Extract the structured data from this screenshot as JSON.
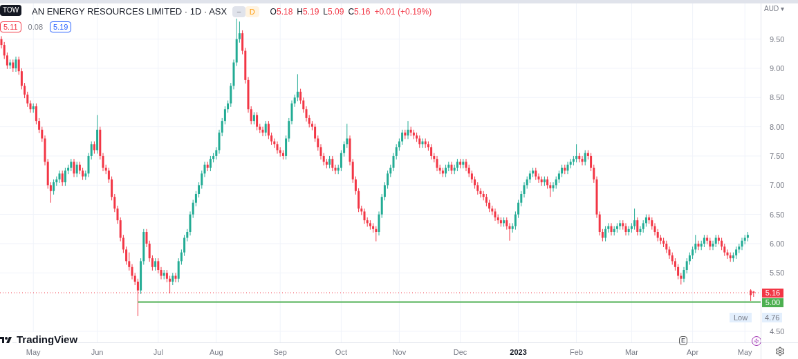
{
  "legend": {
    "tooltip": "TOW",
    "title": "AN ENERGY RESOURCES LIMITED · 1D · ASX",
    "badges": [
      {
        "text": "−",
        "kind": "grey"
      },
      {
        "text": "D",
        "kind": "orange"
      }
    ],
    "ohlc": [
      {
        "label": "O",
        "value": "5.18"
      },
      {
        "label": "H",
        "value": "5.19"
      },
      {
        "label": "L",
        "value": "5.09"
      },
      {
        "label": "C",
        "value": "5.16"
      }
    ],
    "change": "+0.01 (+0.19%)",
    "values": [
      {
        "text": "5.11",
        "kind": "red-box"
      },
      {
        "text": "0.08",
        "kind": "plain"
      },
      {
        "text": "5.19",
        "kind": "blue-box"
      }
    ]
  },
  "price_axis": {
    "currency": "AUD",
    "currency_caret": "▾",
    "low": {
      "label": "Low",
      "value": "4.76"
    }
  },
  "logo": "TradingView",
  "earnings_marker": "E",
  "chart": {
    "xtick_bold": [
      false,
      false,
      false,
      false,
      false,
      false,
      false,
      false,
      true,
      false,
      false,
      false,
      false
    ],
    "chart_data": {
      "type": "candlestick",
      "yticks": [
        {
          "value": 9.5,
          "label": "9.50"
        },
        {
          "value": 9,
          "label": "9.00"
        },
        {
          "value": 8.5,
          "label": "8.50"
        },
        {
          "value": 8,
          "label": "8.00"
        },
        {
          "value": 7.5,
          "label": "7.50"
        },
        {
          "value": 7,
          "label": "7.00"
        },
        {
          "value": 6.5,
          "label": "6.50"
        },
        {
          "value": 6,
          "label": "6.00"
        },
        {
          "value": 5.5,
          "label": "5.50"
        },
        {
          "value": 4.5,
          "label": "4.50"
        }
      ],
      "ylim": [
        4.31,
        10.11
      ],
      "grid": true,
      "ref_lines": [
        {
          "axis": "y",
          "value": 5.16,
          "label": "5.16",
          "color": "#f23645"
        },
        {
          "axis": "y",
          "value": 5,
          "label": "5.00",
          "color": "#4caf50"
        }
      ],
      "categories": [
        null,
        null,
        null,
        null,
        null,
        null,
        null,
        null,
        null,
        null,
        null,
        "May",
        null,
        null,
        null,
        null,
        null,
        null,
        null,
        null,
        null,
        null,
        null,
        null,
        null,
        null,
        null,
        null,
        null,
        null,
        null,
        null,
        null,
        "Jun",
        null,
        null,
        null,
        null,
        null,
        null,
        null,
        null,
        null,
        null,
        null,
        null,
        null,
        null,
        null,
        null,
        null,
        null,
        null,
        null,
        "Jul",
        null,
        null,
        null,
        null,
        null,
        null,
        null,
        null,
        null,
        null,
        null,
        null,
        null,
        null,
        null,
        null,
        null,
        null,
        null,
        "Aug",
        null,
        null,
        null,
        null,
        null,
        null,
        null,
        null,
        null,
        null,
        null,
        null,
        null,
        null,
        null,
        null,
        null,
        null,
        null,
        null,
        null,
        "Sep",
        null,
        null,
        null,
        null,
        null,
        null,
        null,
        null,
        null,
        null,
        null,
        null,
        null,
        null,
        null,
        null,
        null,
        null,
        null,
        null,
        "Oct",
        null,
        null,
        null,
        null,
        null,
        null,
        null,
        null,
        null,
        null,
        null,
        null,
        null,
        null,
        null,
        null,
        null,
        null,
        null,
        "Nov",
        null,
        null,
        null,
        null,
        null,
        null,
        null,
        null,
        null,
        null,
        null,
        null,
        null,
        null,
        null,
        null,
        null,
        null,
        null,
        null,
        "Dec",
        null,
        null,
        null,
        null,
        null,
        null,
        null,
        null,
        null,
        null,
        null,
        null,
        null,
        null,
        null,
        null,
        null,
        null,
        null,
        "2023",
        null,
        null,
        null,
        null,
        null,
        null,
        null,
        null,
        null,
        null,
        null,
        null,
        null,
        null,
        null,
        null,
        null,
        null,
        null,
        "Feb",
        null,
        null,
        null,
        null,
        null,
        null,
        null,
        null,
        null,
        null,
        null,
        null,
        null,
        null,
        null,
        null,
        null,
        null,
        "Mar",
        null,
        null,
        null,
        null,
        null,
        null,
        null,
        null,
        null,
        null,
        null,
        null,
        null,
        null,
        null,
        null,
        null,
        null,
        null,
        null,
        "Apr",
        null,
        null,
        null,
        null,
        null,
        null,
        null,
        null,
        null,
        null,
        null,
        null,
        null,
        null,
        null,
        null,
        null,
        "May",
        null,
        null,
        null
      ],
      "ohlc": [
        [
          9.5,
          9.55,
          9.34,
          9.4
        ],
        [
          9.4,
          9.45,
          9.16,
          9.22
        ],
        [
          9.22,
          9.27,
          8.99,
          9.05
        ],
        [
          9.05,
          9.15,
          8.99,
          9.1
        ],
        [
          9.1,
          9.15,
          8.94,
          9.0
        ],
        [
          9.0,
          9.2,
          8.94,
          9.15
        ],
        [
          9.15,
          9.2,
          8.89,
          8.95
        ],
        [
          8.95,
          9.0,
          8.64,
          8.7
        ],
        [
          8.7,
          8.75,
          8.49,
          8.55
        ],
        [
          8.55,
          8.6,
          8.34,
          8.4
        ],
        [
          8.4,
          8.45,
          8.24,
          8.3
        ],
        [
          8.3,
          8.4,
          8.24,
          8.35
        ],
        [
          8.35,
          8.4,
          8.04,
          8.1
        ],
        [
          8.1,
          8.15,
          7.89,
          7.95
        ],
        [
          7.95,
          8.0,
          7.74,
          7.8
        ],
        [
          7.8,
          7.85,
          7.34,
          7.4
        ],
        [
          7.4,
          7.45,
          6.94,
          7.0
        ],
        [
          7.0,
          7.05,
          6.7,
          6.9
        ],
        [
          6.9,
          7.1,
          6.84,
          7.05
        ],
        [
          7.05,
          7.15,
          6.99,
          7.1
        ],
        [
          7.1,
          7.25,
          7.04,
          7.2
        ],
        [
          7.2,
          7.25,
          6.99,
          7.05
        ],
        [
          7.05,
          7.3,
          6.99,
          7.25
        ],
        [
          7.25,
          7.35,
          7.19,
          7.3
        ],
        [
          7.3,
          7.45,
          7.24,
          7.4
        ],
        [
          7.4,
          7.45,
          7.14,
          7.2
        ],
        [
          7.2,
          7.4,
          7.14,
          7.35
        ],
        [
          7.35,
          7.4,
          7.19,
          7.25
        ],
        [
          7.25,
          7.3,
          7.09,
          7.15
        ],
        [
          7.15,
          7.25,
          7.09,
          7.2
        ],
        [
          7.2,
          7.55,
          7.14,
          7.5
        ],
        [
          7.5,
          7.75,
          7.44,
          7.7
        ],
        [
          7.7,
          7.75,
          7.54,
          7.6
        ],
        [
          7.6,
          8.2,
          7.54,
          7.95
        ],
        [
          7.95,
          8.0,
          7.44,
          7.5
        ],
        [
          7.5,
          7.55,
          7.24,
          7.3
        ],
        [
          7.3,
          7.35,
          7.19,
          7.25
        ],
        [
          7.25,
          7.3,
          7.04,
          7.1
        ],
        [
          7.1,
          7.15,
          6.74,
          6.8
        ],
        [
          6.8,
          6.85,
          6.54,
          6.6
        ],
        [
          6.6,
          6.65,
          6.34,
          6.4
        ],
        [
          6.4,
          6.45,
          6.04,
          6.1
        ],
        [
          6.1,
          6.15,
          5.84,
          5.9
        ],
        [
          5.9,
          5.95,
          5.64,
          5.7
        ],
        [
          5.7,
          5.85,
          5.54,
          5.6
        ],
        [
          5.6,
          5.65,
          5.39,
          5.45
        ],
        [
          5.45,
          5.5,
          5.29,
          5.35
        ],
        [
          5.35,
          5.4,
          4.76,
          5.2
        ],
        [
          5.2,
          5.75,
          5.14,
          5.7
        ],
        [
          5.7,
          6.25,
          5.64,
          6.2
        ],
        [
          6.2,
          6.25,
          5.94,
          6.0
        ],
        [
          6.0,
          6.05,
          5.69,
          5.75
        ],
        [
          5.75,
          5.8,
          5.54,
          5.6
        ],
        [
          5.6,
          5.75,
          5.54,
          5.7
        ],
        [
          5.7,
          5.75,
          5.49,
          5.55
        ],
        [
          5.55,
          5.6,
          5.39,
          5.45
        ],
        [
          5.45,
          5.55,
          5.39,
          5.5
        ],
        [
          5.5,
          5.55,
          5.34,
          5.4
        ],
        [
          5.4,
          5.45,
          5.15,
          5.35
        ],
        [
          5.35,
          5.5,
          5.29,
          5.45
        ],
        [
          5.45,
          5.5,
          5.34,
          5.4
        ],
        [
          5.4,
          5.75,
          5.34,
          5.7
        ],
        [
          5.7,
          5.9,
          5.64,
          5.85
        ],
        [
          5.85,
          6.15,
          5.79,
          6.1
        ],
        [
          6.1,
          6.25,
          6.04,
          6.2
        ],
        [
          6.2,
          6.55,
          6.14,
          6.5
        ],
        [
          6.5,
          6.75,
          6.44,
          6.7
        ],
        [
          6.7,
          6.9,
          6.64,
          6.85
        ],
        [
          6.85,
          7.05,
          6.79,
          7.0
        ],
        [
          7.0,
          7.25,
          6.94,
          7.2
        ],
        [
          7.2,
          7.4,
          7.14,
          7.35
        ],
        [
          7.35,
          7.4,
          7.24,
          7.3
        ],
        [
          7.3,
          7.5,
          7.24,
          7.45
        ],
        [
          7.45,
          7.55,
          7.39,
          7.5
        ],
        [
          7.5,
          7.65,
          7.44,
          7.6
        ],
        [
          7.6,
          7.95,
          7.54,
          7.9
        ],
        [
          7.9,
          8.15,
          7.84,
          8.1
        ],
        [
          8.1,
          8.35,
          8.04,
          8.3
        ],
        [
          8.3,
          8.45,
          8.24,
          8.4
        ],
        [
          8.4,
          8.75,
          8.34,
          8.7
        ],
        [
          8.7,
          9.15,
          8.64,
          9.1
        ],
        [
          9.1,
          9.85,
          9.04,
          9.5
        ],
        [
          9.5,
          9.8,
          9.44,
          9.6
        ],
        [
          9.6,
          9.65,
          9.24,
          9.3
        ],
        [
          9.3,
          9.35,
          8.74,
          8.8
        ],
        [
          8.8,
          8.85,
          8.24,
          8.3
        ],
        [
          8.3,
          8.35,
          8.04,
          8.1
        ],
        [
          8.1,
          8.25,
          8.04,
          8.2
        ],
        [
          8.2,
          8.25,
          7.94,
          8.0
        ],
        [
          8.0,
          8.05,
          7.89,
          7.95
        ],
        [
          7.95,
          8.0,
          7.84,
          7.9
        ],
        [
          7.9,
          8.1,
          7.84,
          8.05
        ],
        [
          8.05,
          8.1,
          7.79,
          7.85
        ],
        [
          7.85,
          7.9,
          7.69,
          7.75
        ],
        [
          7.75,
          7.8,
          7.64,
          7.7
        ],
        [
          7.7,
          7.75,
          7.54,
          7.6
        ],
        [
          7.6,
          7.65,
          7.49,
          7.55
        ],
        [
          7.55,
          7.6,
          7.44,
          7.5
        ],
        [
          7.5,
          7.85,
          7.44,
          7.8
        ],
        [
          7.8,
          8.15,
          7.74,
          8.1
        ],
        [
          8.1,
          8.45,
          8.04,
          8.4
        ],
        [
          8.4,
          8.55,
          8.34,
          8.5
        ],
        [
          8.5,
          8.9,
          8.44,
          8.6
        ],
        [
          8.6,
          8.65,
          8.39,
          8.45
        ],
        [
          8.45,
          8.5,
          8.24,
          8.3
        ],
        [
          8.3,
          8.35,
          8.09,
          8.15
        ],
        [
          8.15,
          8.2,
          7.99,
          8.05
        ],
        [
          8.05,
          8.1,
          7.94,
          8.0
        ],
        [
          8.0,
          8.05,
          7.74,
          7.8
        ],
        [
          7.8,
          7.85,
          7.59,
          7.65
        ],
        [
          7.65,
          7.7,
          7.44,
          7.5
        ],
        [
          7.5,
          7.55,
          7.34,
          7.4
        ],
        [
          7.4,
          7.45,
          7.29,
          7.35
        ],
        [
          7.35,
          7.5,
          7.29,
          7.45
        ],
        [
          7.45,
          7.5,
          7.24,
          7.3
        ],
        [
          7.3,
          7.35,
          7.19,
          7.25
        ],
        [
          7.25,
          7.35,
          7.19,
          7.3
        ],
        [
          7.3,
          7.6,
          7.24,
          7.55
        ],
        [
          7.55,
          7.75,
          7.49,
          7.7
        ],
        [
          7.7,
          8.05,
          7.64,
          7.8
        ],
        [
          7.8,
          7.85,
          7.34,
          7.4
        ],
        [
          7.4,
          7.45,
          7.04,
          7.1
        ],
        [
          7.1,
          7.15,
          6.84,
          6.9
        ],
        [
          6.9,
          6.95,
          6.54,
          6.6
        ],
        [
          6.6,
          6.65,
          6.49,
          6.55
        ],
        [
          6.55,
          6.6,
          6.34,
          6.4
        ],
        [
          6.4,
          6.45,
          6.29,
          6.35
        ],
        [
          6.35,
          6.4,
          6.24,
          6.3
        ],
        [
          6.3,
          6.35,
          6.19,
          6.25
        ],
        [
          6.25,
          6.3,
          6.04,
          6.2
        ],
        [
          6.2,
          6.55,
          6.14,
          6.5
        ],
        [
          6.5,
          6.85,
          6.44,
          6.8
        ],
        [
          6.8,
          7.05,
          6.74,
          7.0
        ],
        [
          7.0,
          7.25,
          6.94,
          7.2
        ],
        [
          7.2,
          7.35,
          7.14,
          7.3
        ],
        [
          7.3,
          7.55,
          7.24,
          7.5
        ],
        [
          7.5,
          7.7,
          7.44,
          7.65
        ],
        [
          7.65,
          7.8,
          7.59,
          7.75
        ],
        [
          7.75,
          7.95,
          7.69,
          7.9
        ],
        [
          7.9,
          7.95,
          7.79,
          7.85
        ],
        [
          7.85,
          8.1,
          7.79,
          7.95
        ],
        [
          7.95,
          8.0,
          7.84,
          7.9
        ],
        [
          7.9,
          7.95,
          7.79,
          7.85
        ],
        [
          7.85,
          7.9,
          7.74,
          7.8
        ],
        [
          7.8,
          7.85,
          7.64,
          7.7
        ],
        [
          7.7,
          7.8,
          7.64,
          7.75
        ],
        [
          7.75,
          7.8,
          7.64,
          7.7
        ],
        [
          7.7,
          7.75,
          7.59,
          7.65
        ],
        [
          7.65,
          7.7,
          7.44,
          7.5
        ],
        [
          7.5,
          7.55,
          7.39,
          7.45
        ],
        [
          7.45,
          7.5,
          7.24,
          7.3
        ],
        [
          7.3,
          7.35,
          7.19,
          7.25
        ],
        [
          7.25,
          7.3,
          7.14,
          7.2
        ],
        [
          7.2,
          7.35,
          7.14,
          7.3
        ],
        [
          7.3,
          7.4,
          7.24,
          7.35
        ],
        [
          7.35,
          7.4,
          7.19,
          7.25
        ],
        [
          7.25,
          7.35,
          7.19,
          7.3
        ],
        [
          7.3,
          7.45,
          7.24,
          7.4
        ],
        [
          7.4,
          7.45,
          7.29,
          7.35
        ],
        [
          7.35,
          7.45,
          7.29,
          7.4
        ],
        [
          7.4,
          7.45,
          7.24,
          7.3
        ],
        [
          7.3,
          7.35,
          7.14,
          7.2
        ],
        [
          7.2,
          7.25,
          7.04,
          7.1
        ],
        [
          7.1,
          7.15,
          6.94,
          7.0
        ],
        [
          7.0,
          7.05,
          6.84,
          6.9
        ],
        [
          6.9,
          6.95,
          6.79,
          6.85
        ],
        [
          6.85,
          6.9,
          6.74,
          6.8
        ],
        [
          6.8,
          6.85,
          6.64,
          6.7
        ],
        [
          6.7,
          6.75,
          6.54,
          6.6
        ],
        [
          6.6,
          6.65,
          6.49,
          6.55
        ],
        [
          6.55,
          6.6,
          6.39,
          6.45
        ],
        [
          6.45,
          6.5,
          6.34,
          6.4
        ],
        [
          6.4,
          6.45,
          6.29,
          6.35
        ],
        [
          6.35,
          6.45,
          6.29,
          6.4
        ],
        [
          6.4,
          6.45,
          6.24,
          6.3
        ],
        [
          6.3,
          6.35,
          6.05,
          6.25
        ],
        [
          6.25,
          6.35,
          6.19,
          6.3
        ],
        [
          6.3,
          6.55,
          6.24,
          6.5
        ],
        [
          6.5,
          6.75,
          6.44,
          6.7
        ],
        [
          6.7,
          6.9,
          6.64,
          6.85
        ],
        [
          6.85,
          7.05,
          6.79,
          7.0
        ],
        [
          7.0,
          7.15,
          6.94,
          7.1
        ],
        [
          7.1,
          7.25,
          7.04,
          7.2
        ],
        [
          7.2,
          7.3,
          7.14,
          7.25
        ],
        [
          7.25,
          7.3,
          7.09,
          7.15
        ],
        [
          7.15,
          7.2,
          7.04,
          7.1
        ],
        [
          7.1,
          7.15,
          6.99,
          7.05
        ],
        [
          7.05,
          7.15,
          6.99,
          7.1
        ],
        [
          7.1,
          7.15,
          6.94,
          7.0
        ],
        [
          7.0,
          7.05,
          6.8,
          6.95
        ],
        [
          6.95,
          7.05,
          6.89,
          7.0
        ],
        [
          7.0,
          7.15,
          6.94,
          7.1
        ],
        [
          7.1,
          7.25,
          7.04,
          7.2
        ],
        [
          7.2,
          7.35,
          7.14,
          7.3
        ],
        [
          7.3,
          7.35,
          7.19,
          7.25
        ],
        [
          7.25,
          7.4,
          7.19,
          7.35
        ],
        [
          7.35,
          7.45,
          7.29,
          7.4
        ],
        [
          7.4,
          7.5,
          7.34,
          7.45
        ],
        [
          7.45,
          7.7,
          7.39,
          7.5
        ],
        [
          7.5,
          7.55,
          7.39,
          7.45
        ],
        [
          7.45,
          7.5,
          7.34,
          7.4
        ],
        [
          7.4,
          7.6,
          7.34,
          7.55
        ],
        [
          7.55,
          7.6,
          7.44,
          7.5
        ],
        [
          7.5,
          7.55,
          7.24,
          7.3
        ],
        [
          7.3,
          7.35,
          7.04,
          7.1
        ],
        [
          7.1,
          7.15,
          6.44,
          6.5
        ],
        [
          6.5,
          6.55,
          6.14,
          6.2
        ],
        [
          6.2,
          6.25,
          6.04,
          6.1
        ],
        [
          6.1,
          6.3,
          6.04,
          6.25
        ],
        [
          6.25,
          6.35,
          6.19,
          6.3
        ],
        [
          6.3,
          6.35,
          6.14,
          6.2
        ],
        [
          6.2,
          6.3,
          6.14,
          6.25
        ],
        [
          6.25,
          6.35,
          6.19,
          6.3
        ],
        [
          6.3,
          6.4,
          6.24,
          6.35
        ],
        [
          6.35,
          6.4,
          6.24,
          6.3
        ],
        [
          6.3,
          6.35,
          6.14,
          6.2
        ],
        [
          6.2,
          6.3,
          6.14,
          6.25
        ],
        [
          6.25,
          6.35,
          6.19,
          6.3
        ],
        [
          6.3,
          6.6,
          6.24,
          6.4
        ],
        [
          6.4,
          6.45,
          6.14,
          6.2
        ],
        [
          6.2,
          6.3,
          6.14,
          6.25
        ],
        [
          6.25,
          6.4,
          6.19,
          6.35
        ],
        [
          6.35,
          6.5,
          6.29,
          6.45
        ],
        [
          6.45,
          6.5,
          6.34,
          6.4
        ],
        [
          6.4,
          6.45,
          6.24,
          6.3
        ],
        [
          6.3,
          6.35,
          6.14,
          6.2
        ],
        [
          6.2,
          6.25,
          6.04,
          6.1
        ],
        [
          6.1,
          6.15,
          5.99,
          6.05
        ],
        [
          6.05,
          6.1,
          5.94,
          6.0
        ],
        [
          6.0,
          6.05,
          5.84,
          5.9
        ],
        [
          5.9,
          5.95,
          5.74,
          5.8
        ],
        [
          5.8,
          5.85,
          5.64,
          5.7
        ],
        [
          5.7,
          5.75,
          5.54,
          5.6
        ],
        [
          5.6,
          5.65,
          5.39,
          5.45
        ],
        [
          5.45,
          5.5,
          5.3,
          5.4
        ],
        [
          5.4,
          5.6,
          5.34,
          5.55
        ],
        [
          5.55,
          5.75,
          5.49,
          5.7
        ],
        [
          5.7,
          5.85,
          5.64,
          5.8
        ],
        [
          5.8,
          5.95,
          5.74,
          5.9
        ],
        [
          5.9,
          6.15,
          5.84,
          6.0
        ],
        [
          6.0,
          6.05,
          5.89,
          5.95
        ],
        [
          5.95,
          6.05,
          5.89,
          6.0
        ],
        [
          6.0,
          6.15,
          5.94,
          6.1
        ],
        [
          6.1,
          6.15,
          5.99,
          6.05
        ],
        [
          6.05,
          6.1,
          5.89,
          5.95
        ],
        [
          5.95,
          6.05,
          5.89,
          6.0
        ],
        [
          6.0,
          6.15,
          5.94,
          6.1
        ],
        [
          6.1,
          6.15,
          5.99,
          6.05
        ],
        [
          6.05,
          6.1,
          5.89,
          5.95
        ],
        [
          5.95,
          6.0,
          5.79,
          5.85
        ],
        [
          5.85,
          5.9,
          5.74,
          5.8
        ],
        [
          5.8,
          5.85,
          5.69,
          5.75
        ],
        [
          5.75,
          5.85,
          5.69,
          5.8
        ],
        [
          5.8,
          5.95,
          5.74,
          5.9
        ],
        [
          5.9,
          6.0,
          5.84,
          5.95
        ],
        [
          5.95,
          6.1,
          5.89,
          6.05
        ],
        [
          6.05,
          6.15,
          5.99,
          6.1
        ],
        [
          6.1,
          6.2,
          6.04,
          6.15
        ],
        [
          5.2,
          5.22,
          5.02,
          5.12
        ],
        [
          5.18,
          5.19,
          5.09,
          5.16
        ]
      ]
    }
  }
}
